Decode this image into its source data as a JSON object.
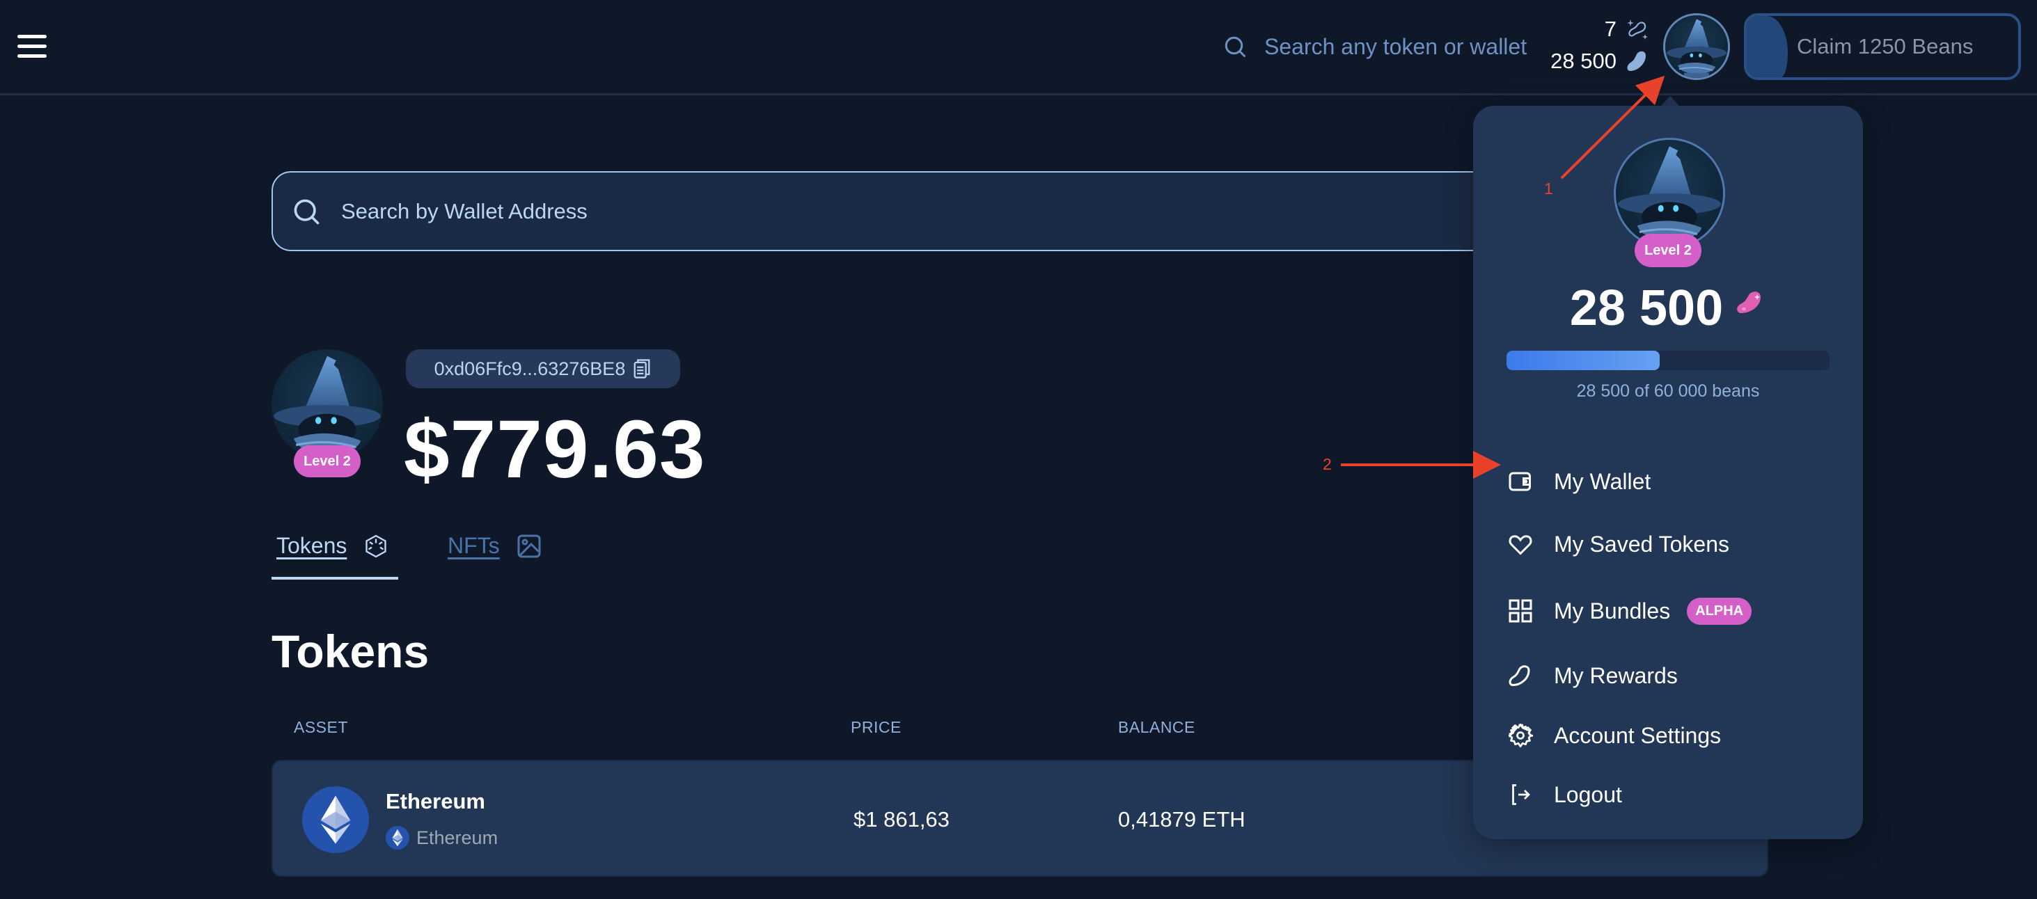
{
  "header": {
    "menu_icon": "hamburger-menu-icon",
    "search_placeholder": "Search any token or wallet",
    "streak_count": "7",
    "streak_icon": "sparkle-bean-icon",
    "beans_count": "28 500",
    "beans_icon": "bean-icon",
    "avatar": "wizard-avatar",
    "claim_label": "Claim 1250 Beans",
    "claim_progress": 0.15
  },
  "wallet_search": {
    "placeholder": "Search by Wallet Address"
  },
  "profile": {
    "level": "Level 2",
    "address": "0xd06Ffc9...63276BE8",
    "copy_icon": "copy-icon",
    "balance": "$779.63"
  },
  "tabs": [
    {
      "label": "Tokens",
      "icon": "cube-icon",
      "active": true
    },
    {
      "label": "NFTs",
      "icon": "image-icon",
      "active": false
    }
  ],
  "tokens": {
    "title": "Tokens",
    "columns": [
      "ASSET",
      "PRICE",
      "BALANCE"
    ],
    "rows": [
      {
        "name": "Ethereum",
        "chain": "Ethereum",
        "price": "$1 861,63",
        "balance": "0,41879 ETH"
      }
    ]
  },
  "dropdown": {
    "level": "Level 2",
    "beans": "28 500",
    "progress": 0.475,
    "progress_caption": "28 500 of 60 000 beans",
    "items": [
      {
        "label": "My Wallet",
        "icon": "wallet-icon"
      },
      {
        "label": "My Saved Tokens",
        "icon": "heart-icon"
      },
      {
        "label": "My Bundles",
        "icon": "grid-icon",
        "badge": "ALPHA"
      },
      {
        "label": "My Rewards",
        "icon": "bean-outline-icon"
      },
      {
        "label": "Account Settings",
        "icon": "gear-icon"
      },
      {
        "label": "Logout",
        "icon": "logout-icon"
      }
    ]
  },
  "annotations": [
    {
      "label": "1",
      "color": "#e8432a"
    },
    {
      "label": "2",
      "color": "#e8432a"
    }
  ]
}
